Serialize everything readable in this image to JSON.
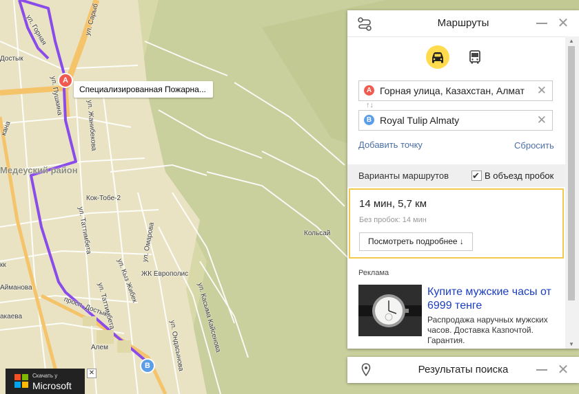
{
  "map": {
    "start_label": "Специализированная Пожарна...",
    "pin_a": "A",
    "pin_b": "B",
    "district": "Медеуский район",
    "labels": {
      "dostyk_top": "Достык",
      "kana": "кана",
      "gornaya": "ул. Горная",
      "pushkina": "ул. Пушкина",
      "saryb": "ул. Сарыб",
      "zhanibekova": "ул. Жанибекова",
      "kok_tobe": "Кок-Тобе-2",
      "tattimbeta": "ул. Таттимбета",
      "omarova": "ул. Омарова",
      "kyz_zhibek": "ул. Кыз Жибек",
      "zhk": "ЖК Европолис",
      "tattimbeta2": "ул. Таттимбета",
      "kaysenova": "ул. Касыма Кайсенова",
      "ondasynova": "ул. Ондасынова",
      "kolsay": "Кольсай",
      "prosp_dostyk": "просп. Достык",
      "alem": "Алем",
      "aimanova": "Айманова",
      "akaeva": "акаева",
      "kk": "кк"
    }
  },
  "route_panel": {
    "title": "Маршруты",
    "icons": {
      "route": "route-icon",
      "minimize": "minimize-icon",
      "close": "close-icon",
      "car": "car-icon",
      "bus": "bus-icon"
    },
    "mode_selected": "car",
    "from": {
      "marker": "A",
      "value": "Горная улица, Казахстан, Алмат",
      "color": "#f05a4f"
    },
    "to": {
      "marker": "B",
      "value": "Royal Tulip Almaty",
      "color": "#5b9ee8"
    },
    "swap_symbol": "↑↓",
    "add_point": "Добавить точку",
    "reset": "Сбросить",
    "variants_label": "Варианты маршрутов",
    "avoid_traffic_label": "В объезд пробок",
    "avoid_traffic_checked": true,
    "route": {
      "summary": "14 мин, 5,7 км",
      "no_traffic": "Без пробок: 14 мин",
      "details_button": "Посмотреть подробнее ↓"
    },
    "ad": {
      "label": "Реклама",
      "title": "Купите мужские часы от 6999 тенге",
      "description": "Распродажа наручных мужских часов. Доставка Казпочтой. Гарантия."
    }
  },
  "search_panel": {
    "title": "Результаты поиска"
  },
  "ms_banner": {
    "small": "Скачать у",
    "big": "Microsoft"
  },
  "colors": {
    "route": "#8a4ce8",
    "highlight": "#f2c94c",
    "accent_yellow": "#ffdb4d",
    "link": "#4b6fa5",
    "ad_title": "#1a3dc1"
  }
}
